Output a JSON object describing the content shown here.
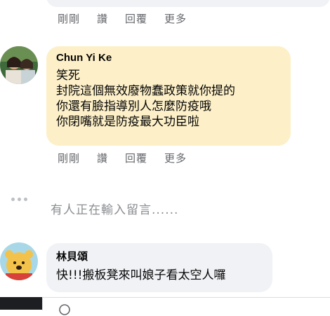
{
  "top_actions": {
    "just_now": "剛剛",
    "like": "讚",
    "reply": "回覆",
    "more": "更多"
  },
  "comment1": {
    "author": "Chun Yi Ke",
    "lines": [
      "笑死",
      "封院這個無效廢物蠢政策就你提的",
      "你還有臉指導別人怎麼防疫哦",
      "你閉嘴就是防疫最大功臣啦"
    ],
    "actions": {
      "just_now": "剛剛",
      "like": "讚",
      "reply": "回覆",
      "more": "更多"
    },
    "bubble_color": "#fdf0c8"
  },
  "typing_indicator": {
    "text": "有人正在輸入留言......"
  },
  "comment2": {
    "author": "林貝頌",
    "text": "快!!!搬板凳來叫娘子看太空人囉",
    "bubble_color": "#f0f2f5"
  }
}
